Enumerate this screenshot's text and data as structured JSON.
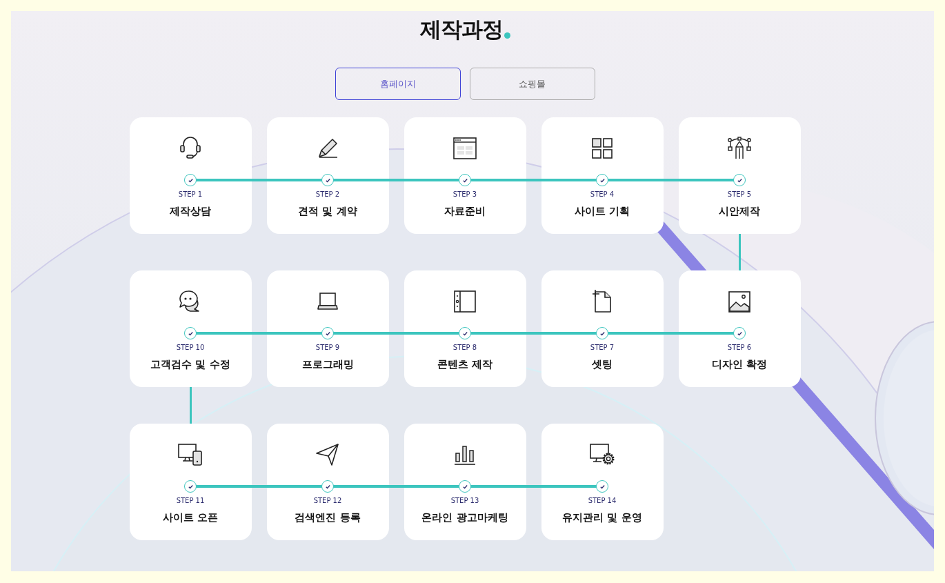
{
  "title": "제작과정",
  "tabs": [
    {
      "label": "홈페이지",
      "selected": true
    },
    {
      "label": "쇼핑몰",
      "selected": false
    }
  ],
  "rows": [
    {
      "steps": [
        {
          "step": "STEP 1",
          "title": "제작상담",
          "checked": true
        },
        {
          "step": "STEP 2",
          "title": "견적 및 계약",
          "checked": true
        },
        {
          "step": "STEP 3",
          "title": "자료준비",
          "checked": true
        },
        {
          "step": "STEP 4",
          "title": "사이트 기획",
          "checked": true
        },
        {
          "step": "STEP 5",
          "title": "시안제작",
          "checked": true
        }
      ]
    },
    {
      "steps": [
        {
          "step": "STEP 10",
          "title": "고객검수 및 수정",
          "checked": true
        },
        {
          "step": "STEP 9",
          "title": "프로그래밍",
          "checked": true
        },
        {
          "step": "STEP 8",
          "title": "콘텐츠 제작",
          "checked": true
        },
        {
          "step": "STEP 7",
          "title": "셋팅",
          "checked": true
        },
        {
          "step": "STEP 6",
          "title": "디자인 확정",
          "checked": true
        }
      ]
    },
    {
      "steps": [
        {
          "step": "STEP 11",
          "title": "사이트 오픈",
          "checked": true
        },
        {
          "step": "STEP 12",
          "title": "검색엔진 등록",
          "checked": true
        },
        {
          "step": "STEP 13",
          "title": "온라인 광고마케팅",
          "checked": true
        },
        {
          "step": "STEP 14",
          "title": "유지관리 및 운영",
          "checked": true
        }
      ]
    }
  ]
}
